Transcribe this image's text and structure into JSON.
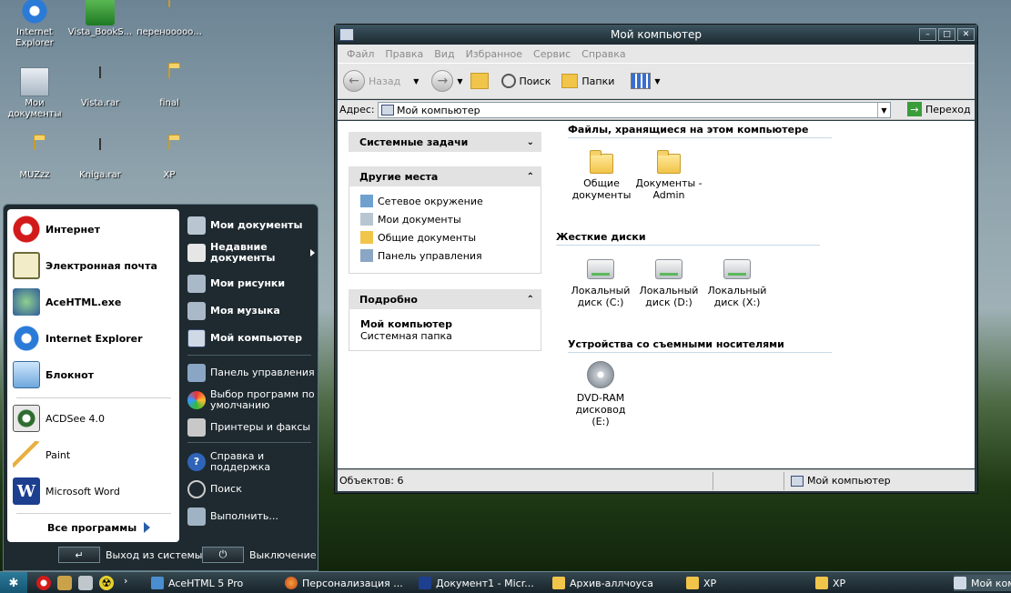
{
  "desktop_icons": [
    {
      "label": "Internet Explorer",
      "type": "ie"
    },
    {
      "label": "Vista_BookS...",
      "type": "book"
    },
    {
      "label": "перенооооо...",
      "type": "folder"
    },
    {
      "label": "Мои документы",
      "type": "mydocs"
    },
    {
      "label": "Vista.rar",
      "type": "rar"
    },
    {
      "label": "final",
      "type": "folder"
    },
    {
      "label": "MUZzz",
      "type": "folder"
    },
    {
      "label": "Kniga.rar",
      "type": "rar"
    },
    {
      "label": "XP",
      "type": "folder"
    }
  ],
  "start_menu": {
    "pinned": [
      {
        "label": "Интернет",
        "icon": "opera-icon"
      },
      {
        "label": "Электронная почта",
        "icon": "mail-icon"
      },
      {
        "label": "AceHTML.exe",
        "icon": "acehtml-icon"
      },
      {
        "label": "Internet Explorer",
        "icon": "ie-icon"
      },
      {
        "label": "Блокнот",
        "icon": "notepad-icon"
      }
    ],
    "recent": [
      {
        "label": "ACDSee 4.0",
        "icon": "acdsee-icon"
      },
      {
        "label": "Paint",
        "icon": "paint-icon"
      },
      {
        "label": "Microsoft Word",
        "icon": "word-icon"
      }
    ],
    "all_programs": "Все программы",
    "right": [
      {
        "label": "Мои документы",
        "bold": true
      },
      {
        "label": "Недавние документы",
        "bold": true
      },
      {
        "label": "Мои рисунки",
        "bold": true
      },
      {
        "label": "Моя музыка",
        "bold": true
      },
      {
        "label": "Мой компьютер",
        "bold": true
      },
      {
        "label": "Панель управления",
        "bold": false
      },
      {
        "label": "Выбор программ по умолчанию",
        "bold": false
      },
      {
        "label": "Принтеры и факсы",
        "bold": false
      },
      {
        "label": "Справка и поддержка",
        "bold": false
      },
      {
        "label": "Поиск",
        "bold": false
      },
      {
        "label": "Выполнить...",
        "bold": false
      }
    ],
    "logoff": "Выход из системы",
    "shutdown": "Выключение"
  },
  "window": {
    "title": "Мой компьютер",
    "menu": [
      "Файл",
      "Правка",
      "Вид",
      "Избранное",
      "Сервис",
      "Справка"
    ],
    "toolbar": {
      "back": "Назад",
      "search": "Поиск",
      "folders": "Папки"
    },
    "address_label": "Адрес:",
    "address_value": "Мой компьютер",
    "go": "Переход",
    "panels": {
      "system_tasks": "Системные задачи",
      "other_places": "Другие места",
      "places": [
        "Сетевое окружение",
        "Мои документы",
        "Общие документы",
        "Панель управления"
      ],
      "details": "Подробно",
      "details_name": "Мой компьютер",
      "details_type": "Системная папка"
    },
    "groups": {
      "files": "Файлы, хранящиеся на этом компьютере",
      "files_items": [
        "Общие документы",
        "Документы - Admin"
      ],
      "drives": "Жесткие диски",
      "drives_items": [
        "Локальный диск (C:)",
        "Локальный диск (D:)",
        "Локальный диск (X:)"
      ],
      "removable": "Устройства со съемными носителями",
      "removable_items": [
        "DVD-RAM дисковод (E:)"
      ]
    },
    "status": {
      "objects": "Объектов: 6",
      "location": "Мой компьютер"
    }
  },
  "taskbar": {
    "items": [
      {
        "label": "AceHTML 5 Pro"
      },
      {
        "label": "Персонализация ..."
      },
      {
        "label": "Документ1 - Micr..."
      },
      {
        "label": "Архив-аллчоуса"
      },
      {
        "label": "XP"
      },
      {
        "label": "XP"
      },
      {
        "label": "Мой компьютер"
      }
    ]
  }
}
